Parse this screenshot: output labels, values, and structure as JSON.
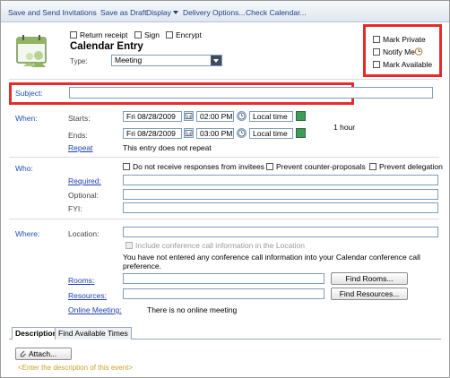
{
  "toolbar": {
    "save_send": "Save and Send Invitations",
    "save_draft": "Save as Draft",
    "display": "Display",
    "delivery": "Delivery Options...",
    "check_calendar": "Check Calendar..."
  },
  "header": {
    "return_receipt": "Return receipt",
    "sign": "Sign",
    "encrypt": "Encrypt",
    "title": "Calendar Entry",
    "type_label": "Type:",
    "type_value": "Meeting"
  },
  "options": {
    "mark_private": "Mark Private",
    "notify_me": "Notify Me",
    "mark_available": "Mark Available"
  },
  "subject": {
    "label": "Subject:",
    "value": ""
  },
  "when": {
    "label": "When:",
    "starts_label": "Starts:",
    "start_date": "Fri 08/28/2009",
    "start_time": "02:00 PM",
    "start_tz": "Local time",
    "duration": "1 hour",
    "ends_label": "Ends:",
    "end_date": "Fri 08/28/2009",
    "end_time": "03:00 PM",
    "end_tz": "Local time",
    "repeat_link": "Repeat",
    "repeat_text": "This entry does not repeat"
  },
  "who": {
    "label": "Who:",
    "no_responses": "Do not receive responses from invitees",
    "prevent_counter": "Prevent counter-proposals",
    "prevent_delegation": "Prevent delegation",
    "required_link": "Required:",
    "optional_label": "Optional:",
    "fyi_label": "FYI:"
  },
  "where": {
    "label": "Where:",
    "location_label": "Location:",
    "conf_checkbox": "Include conference call information in the Location",
    "conf_note_1": "You have not entered any conference call information into your Calendar conference call",
    "conf_note_2": "preference.",
    "rooms_link": "Rooms:",
    "find_rooms": "Find Rooms...",
    "resources_link": "Resources:",
    "find_resources": "Find Resources...",
    "online_meeting_link": "Online Meeting:",
    "online_meeting_text": "There is no online meeting"
  },
  "tabs": {
    "description": "Description",
    "find_times": "Find Available Times"
  },
  "description": {
    "attach": "Attach...",
    "placeholder": "<Enter the description of this event>"
  },
  "colors": {
    "highlight": "#e52b2b",
    "link": "#1f3fb0",
    "label": "#1f4fbf"
  }
}
